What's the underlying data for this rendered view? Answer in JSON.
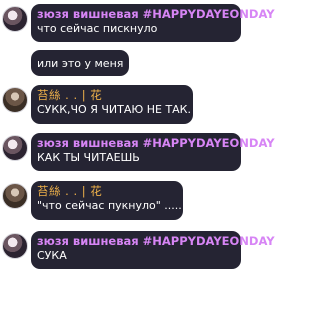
{
  "messages": [
    {
      "author": "зюзя вишневая #HAPPYDAYEONDAY",
      "text": "что сейчас пискнуло"
    },
    {
      "author": "",
      "text": "или это у меня"
    },
    {
      "author": "苔絲 . . | 花",
      "text": "СУКК,ЧО Я ЧИТАЮ НЕ ТАК."
    },
    {
      "author": "зюзя вишневая #HAPPYDAYEONDAY",
      "text": "КАК ТЫ ЧИТАЕШЬ"
    },
    {
      "author": "苔絲 . . | 花",
      "text": "\"что сейчас пукнуло\" ....."
    },
    {
      "author": "зюзя вишневая #HAPPYDAYEONDAY",
      "text": "СУКА"
    }
  ],
  "colors": {
    "bubble": "#252433",
    "name_purple": "#d785f5",
    "name_orange": "#f0b24a"
  }
}
